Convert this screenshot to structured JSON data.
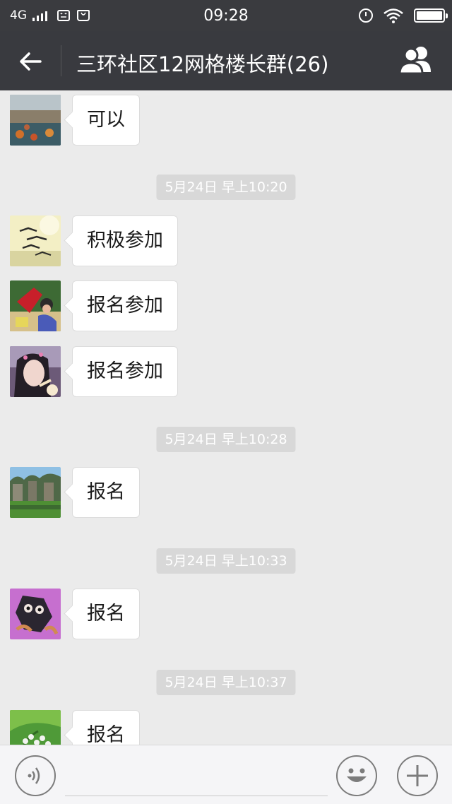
{
  "status_bar": {
    "network": "4G",
    "time": "09:28",
    "icons": [
      "signal-icon",
      "message-icon",
      "bag-icon",
      "alarm-icon",
      "wifi-icon",
      "battery-icon"
    ]
  },
  "nav": {
    "title": "三环社区12网格楼长群(26)",
    "back_icon": "back-arrow-icon",
    "group_icon": "group-members-icon"
  },
  "chat": {
    "items": [
      {
        "type": "message",
        "text": "可以",
        "avatar": "coastline-avatar"
      },
      {
        "type": "timestamp",
        "text": "5月24日 早上10:20"
      },
      {
        "type": "message",
        "text": "积极参加",
        "avatar": "birds-avatar"
      },
      {
        "type": "message",
        "text": "报名参加",
        "avatar": "people-avatar"
      },
      {
        "type": "message",
        "text": "报名参加",
        "avatar": "girl-avatar"
      },
      {
        "type": "timestamp",
        "text": "5月24日 早上10:28"
      },
      {
        "type": "message",
        "text": "报名",
        "avatar": "landscape-avatar"
      },
      {
        "type": "timestamp",
        "text": "5月24日 早上10:33"
      },
      {
        "type": "message",
        "text": "报名",
        "avatar": "cartoon-avatar"
      },
      {
        "type": "timestamp",
        "text": "5月24日 早上10:37"
      },
      {
        "type": "message",
        "text": "报名",
        "avatar": "flowers-avatar"
      }
    ]
  },
  "input_bar": {
    "input_value": "",
    "voice_icon": "voice-icon",
    "emoji_icon": "emoji-icon",
    "plus_icon": "plus-icon"
  },
  "colors": {
    "header_bg": "#393a3f",
    "chat_bg": "#ebebeb",
    "bubble_bg": "#ffffff",
    "timestamp_bg": "#d8d8d8"
  }
}
